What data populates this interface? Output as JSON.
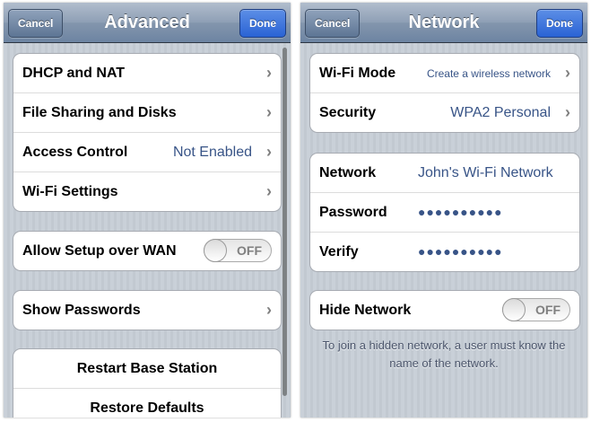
{
  "left_screen": {
    "nav": {
      "title": "Advanced",
      "cancel_label": "Cancel",
      "done_label": "Done"
    },
    "group1": [
      {
        "label": "DHCP and NAT",
        "value": ""
      },
      {
        "label": "File Sharing and Disks",
        "value": ""
      },
      {
        "label": "Access Control",
        "value": "Not Enabled"
      },
      {
        "label": "Wi-Fi Settings",
        "value": ""
      }
    ],
    "wan_setup": {
      "label": "Allow Setup over WAN",
      "toggle": "OFF"
    },
    "show_passwords": {
      "label": "Show Passwords"
    },
    "actions": [
      "Restart Base Station",
      "Restore Defaults"
    ]
  },
  "right_screen": {
    "nav": {
      "title": "Network",
      "cancel_label": "Cancel",
      "done_label": "Done"
    },
    "mode": {
      "label": "Wi-Fi Mode",
      "value": "Create a wireless network"
    },
    "security": {
      "label": "Security",
      "value": "WPA2 Personal"
    },
    "network": {
      "label": "Network",
      "value": "John's Wi-Fi Network"
    },
    "password": {
      "label": "Password",
      "value": "●●●●●●●●●●"
    },
    "verify": {
      "label": "Verify",
      "value": "●●●●●●●●●●"
    },
    "hide_network": {
      "label": "Hide Network",
      "toggle": "OFF"
    },
    "footnote": "To join a hidden network, a user must know the name of the network."
  },
  "icons": {
    "disclosure": "chevron-right-icon"
  },
  "colors": {
    "value_blue": "#385487",
    "done_blue": "#2a63d4",
    "nav_gray": "#6d84a2"
  }
}
